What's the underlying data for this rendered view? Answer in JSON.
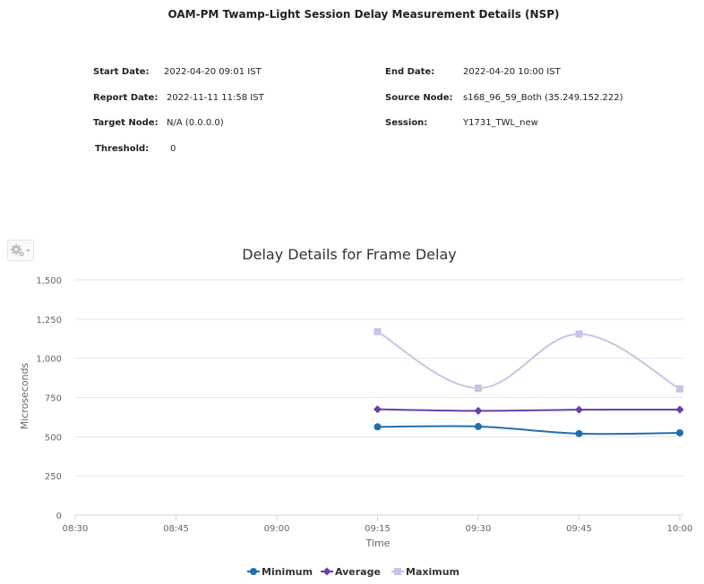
{
  "report": {
    "title": "OAM-PM Twamp-Light Session Delay Measurement Details (NSP)",
    "fields": [
      {
        "label": "Start Date:",
        "value": "2022-04-20 09:01 IST"
      },
      {
        "label": "End Date:",
        "value": "2022-04-20 10:00 IST"
      },
      {
        "label": "Report Date:",
        "value": "2022-11-11 11:58 IST"
      },
      {
        "label": "Source Node:",
        "value": "s168_96_59_Both (35.249.152.222)"
      },
      {
        "label": "Target Node:",
        "value": "N/A (0.0.0.0)"
      },
      {
        "label": "Session:",
        "value": "Y1731_TWL_new"
      },
      {
        "label": "Threshold:",
        "value": "0"
      }
    ]
  },
  "toolbar": {
    "settings_icon": "gear-icon"
  },
  "chart_data": {
    "type": "line",
    "title": "Delay Details for Frame Delay",
    "xlabel": "Time",
    "ylabel": "Microseconds",
    "x_ticks": [
      "08:30",
      "08:45",
      "09:00",
      "09:15",
      "09:30",
      "09:45",
      "10:00"
    ],
    "y_ticks": [
      "0",
      "250",
      "500",
      "750",
      "1,000",
      "1,250",
      "1,500"
    ],
    "ylim": [
      0,
      1500
    ],
    "grid": true,
    "legend_position": "bottom",
    "series": [
      {
        "name": "Minimum",
        "color": "#1f6fb0",
        "marker": "circle",
        "x": [
          "09:15",
          "09:30",
          "09:45",
          "10:00"
        ],
        "values": [
          563,
          565,
          520,
          525
        ]
      },
      {
        "name": "Average",
        "color": "#6a3fa8",
        "marker": "diamond",
        "x": [
          "09:15",
          "09:30",
          "09:45",
          "10:00"
        ],
        "values": [
          675,
          665,
          672,
          673
        ]
      },
      {
        "name": "Maximum",
        "color": "#cbc2e8",
        "marker": "square",
        "x": [
          "09:15",
          "09:30",
          "09:45",
          "10:00"
        ],
        "values": [
          1170,
          810,
          1155,
          805
        ]
      }
    ]
  }
}
